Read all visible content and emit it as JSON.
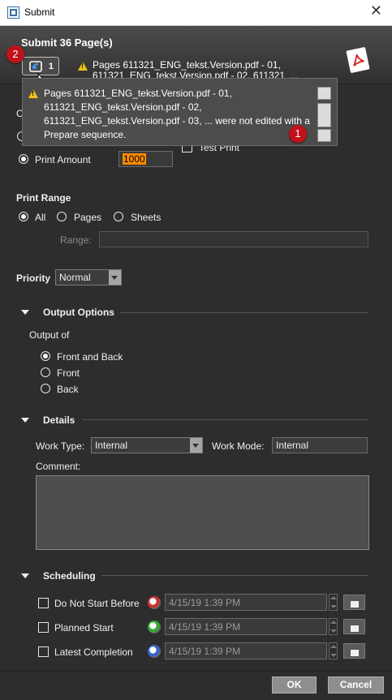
{
  "window": {
    "title": "Submit"
  },
  "header": {
    "heading": "Submit 36 Page(s)",
    "message_count": "1",
    "warning_line1": "Pages 611321_ENG_tekst.Version.pdf - 01,",
    "warning_line2": "611321_ENG_tekst.Version.pdf - 02, 611321_..."
  },
  "tooltip": {
    "line1": "Pages 611321_ENG_tekst.Version.pdf - 01,",
    "line2": "611321_ENG_tekst.Version.pdf - 02,",
    "line3": "611321_ENG_tekst.Version.pdf - 03, ... were not edited with a",
    "line4": "Prepare sequence."
  },
  "callouts": {
    "badge1": "1",
    "badge2": "2"
  },
  "print_amount": {
    "label": "Print Amount",
    "value": "1000",
    "test_print_label": "Test Print"
  },
  "print_range": {
    "heading": "Print Range",
    "options": [
      "All",
      "Pages",
      "Sheets"
    ],
    "selected": "All",
    "range_label": "Range:",
    "range_value": ""
  },
  "priority": {
    "label": "Priority",
    "value": "Normal"
  },
  "output_options": {
    "heading": "Output Options",
    "output_of_label": "Output of",
    "options": [
      "Front and Back",
      "Front",
      "Back"
    ],
    "selected": "Front and Back"
  },
  "details": {
    "heading": "Details",
    "work_type_label": "Work Type:",
    "work_type_value": "Internal",
    "work_mode_label": "Work Mode:",
    "work_mode_value": "Internal",
    "comment_label": "Comment:",
    "comment_value": ""
  },
  "scheduling": {
    "heading": "Scheduling",
    "rows": [
      {
        "label": "Do Not Start Before",
        "date": "4/15/19 1:39 PM"
      },
      {
        "label": "Planned Start",
        "date": "4/15/19 1:39 PM"
      },
      {
        "label": "Latest Completion",
        "date": "4/15/19 1:39 PM"
      }
    ]
  },
  "footer": {
    "ok_label": "OK",
    "cancel_label": "Cancel"
  },
  "colors": {
    "badge": "#c0121b",
    "warning": "#f3c21b",
    "print_amount_bg": "#ff8c00"
  }
}
